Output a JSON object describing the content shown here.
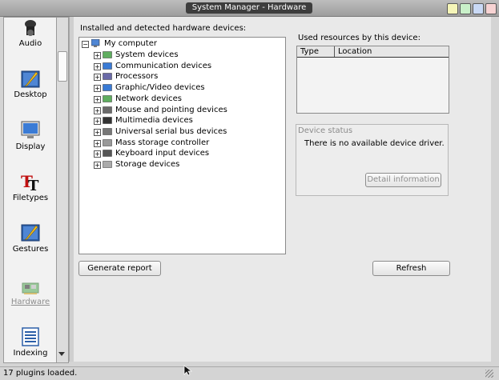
{
  "window": {
    "title": "System Manager - Hardware"
  },
  "sidebar": {
    "items": [
      {
        "label": "Audio",
        "icon": "speaker-icon"
      },
      {
        "label": "Desktop",
        "icon": "desktop-icon"
      },
      {
        "label": "Display",
        "icon": "monitor-icon"
      },
      {
        "label": "Filetypes",
        "icon": "filetypes-icon"
      },
      {
        "label": "Gestures",
        "icon": "gestures-icon"
      },
      {
        "label": "Hardware",
        "icon": "hardware-card-icon",
        "selected": true
      },
      {
        "label": "Indexing",
        "icon": "indexing-icon"
      }
    ]
  },
  "main": {
    "installed_label": "Installed and detected hardware devices:",
    "tree": {
      "root": "My computer",
      "children": [
        "System devices",
        "Communication devices",
        "Processors",
        "Graphic/Video devices",
        "Network devices",
        "Mouse and pointing devices",
        "Multimedia devices",
        "Universal serial bus devices",
        "Mass storage controller",
        "Keyboard input devices",
        "Storage devices"
      ]
    },
    "resources": {
      "label": "Used resources by this device:",
      "columns": [
        "Type",
        "Location"
      ]
    },
    "device_status": {
      "title": "Device status",
      "message": "There is no available device driver.",
      "detail_button": "Detail information"
    },
    "generate_button": "Generate report",
    "refresh_button": "Refresh"
  },
  "statusbar": {
    "text": "17 plugins loaded."
  },
  "colors": {
    "accent_window_buttons": [
      "#f5f5b8",
      "#c9f0c9",
      "#c9d9f5",
      "#f7d3d3"
    ]
  }
}
